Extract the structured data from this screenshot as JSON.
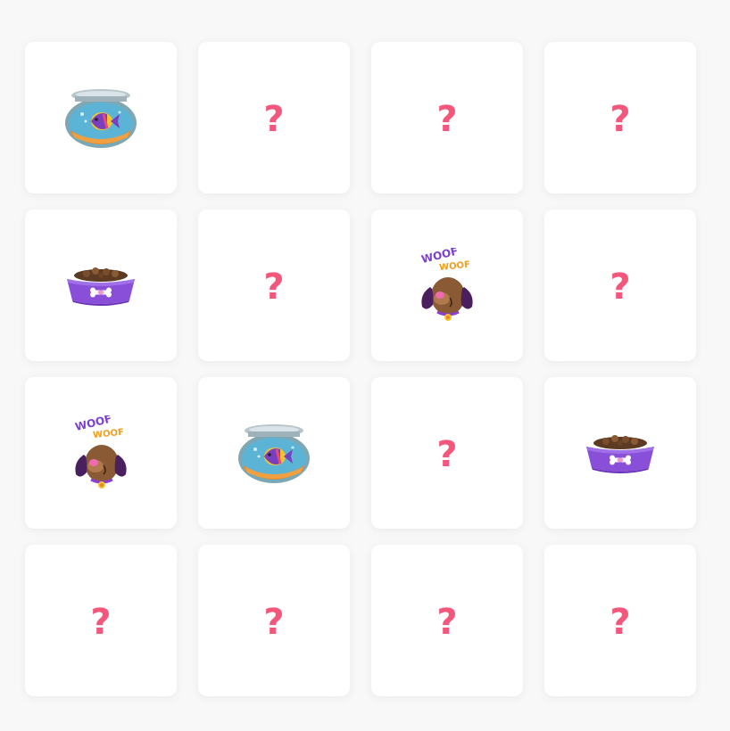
{
  "game": {
    "type": "memory-match",
    "hidden_symbol": "?",
    "cards": [
      {
        "state": "revealed",
        "icon": "fishbowl-icon"
      },
      {
        "state": "hidden",
        "icon": ""
      },
      {
        "state": "hidden",
        "icon": ""
      },
      {
        "state": "hidden",
        "icon": ""
      },
      {
        "state": "revealed",
        "icon": "dog-bowl-icon"
      },
      {
        "state": "hidden",
        "icon": ""
      },
      {
        "state": "revealed",
        "icon": "dog-woof-icon"
      },
      {
        "state": "hidden",
        "icon": ""
      },
      {
        "state": "revealed",
        "icon": "dog-woof-icon"
      },
      {
        "state": "revealed",
        "icon": "fishbowl-icon"
      },
      {
        "state": "hidden",
        "icon": ""
      },
      {
        "state": "revealed",
        "icon": "dog-bowl-icon"
      },
      {
        "state": "hidden",
        "icon": ""
      },
      {
        "state": "hidden",
        "icon": ""
      },
      {
        "state": "hidden",
        "icon": ""
      },
      {
        "state": "hidden",
        "icon": ""
      }
    ],
    "woof_text": [
      "WOOF",
      "WOOF"
    ]
  },
  "colors": {
    "background": "#f8f8f8",
    "card": "#ffffff",
    "question_mark": "#f4577c"
  }
}
